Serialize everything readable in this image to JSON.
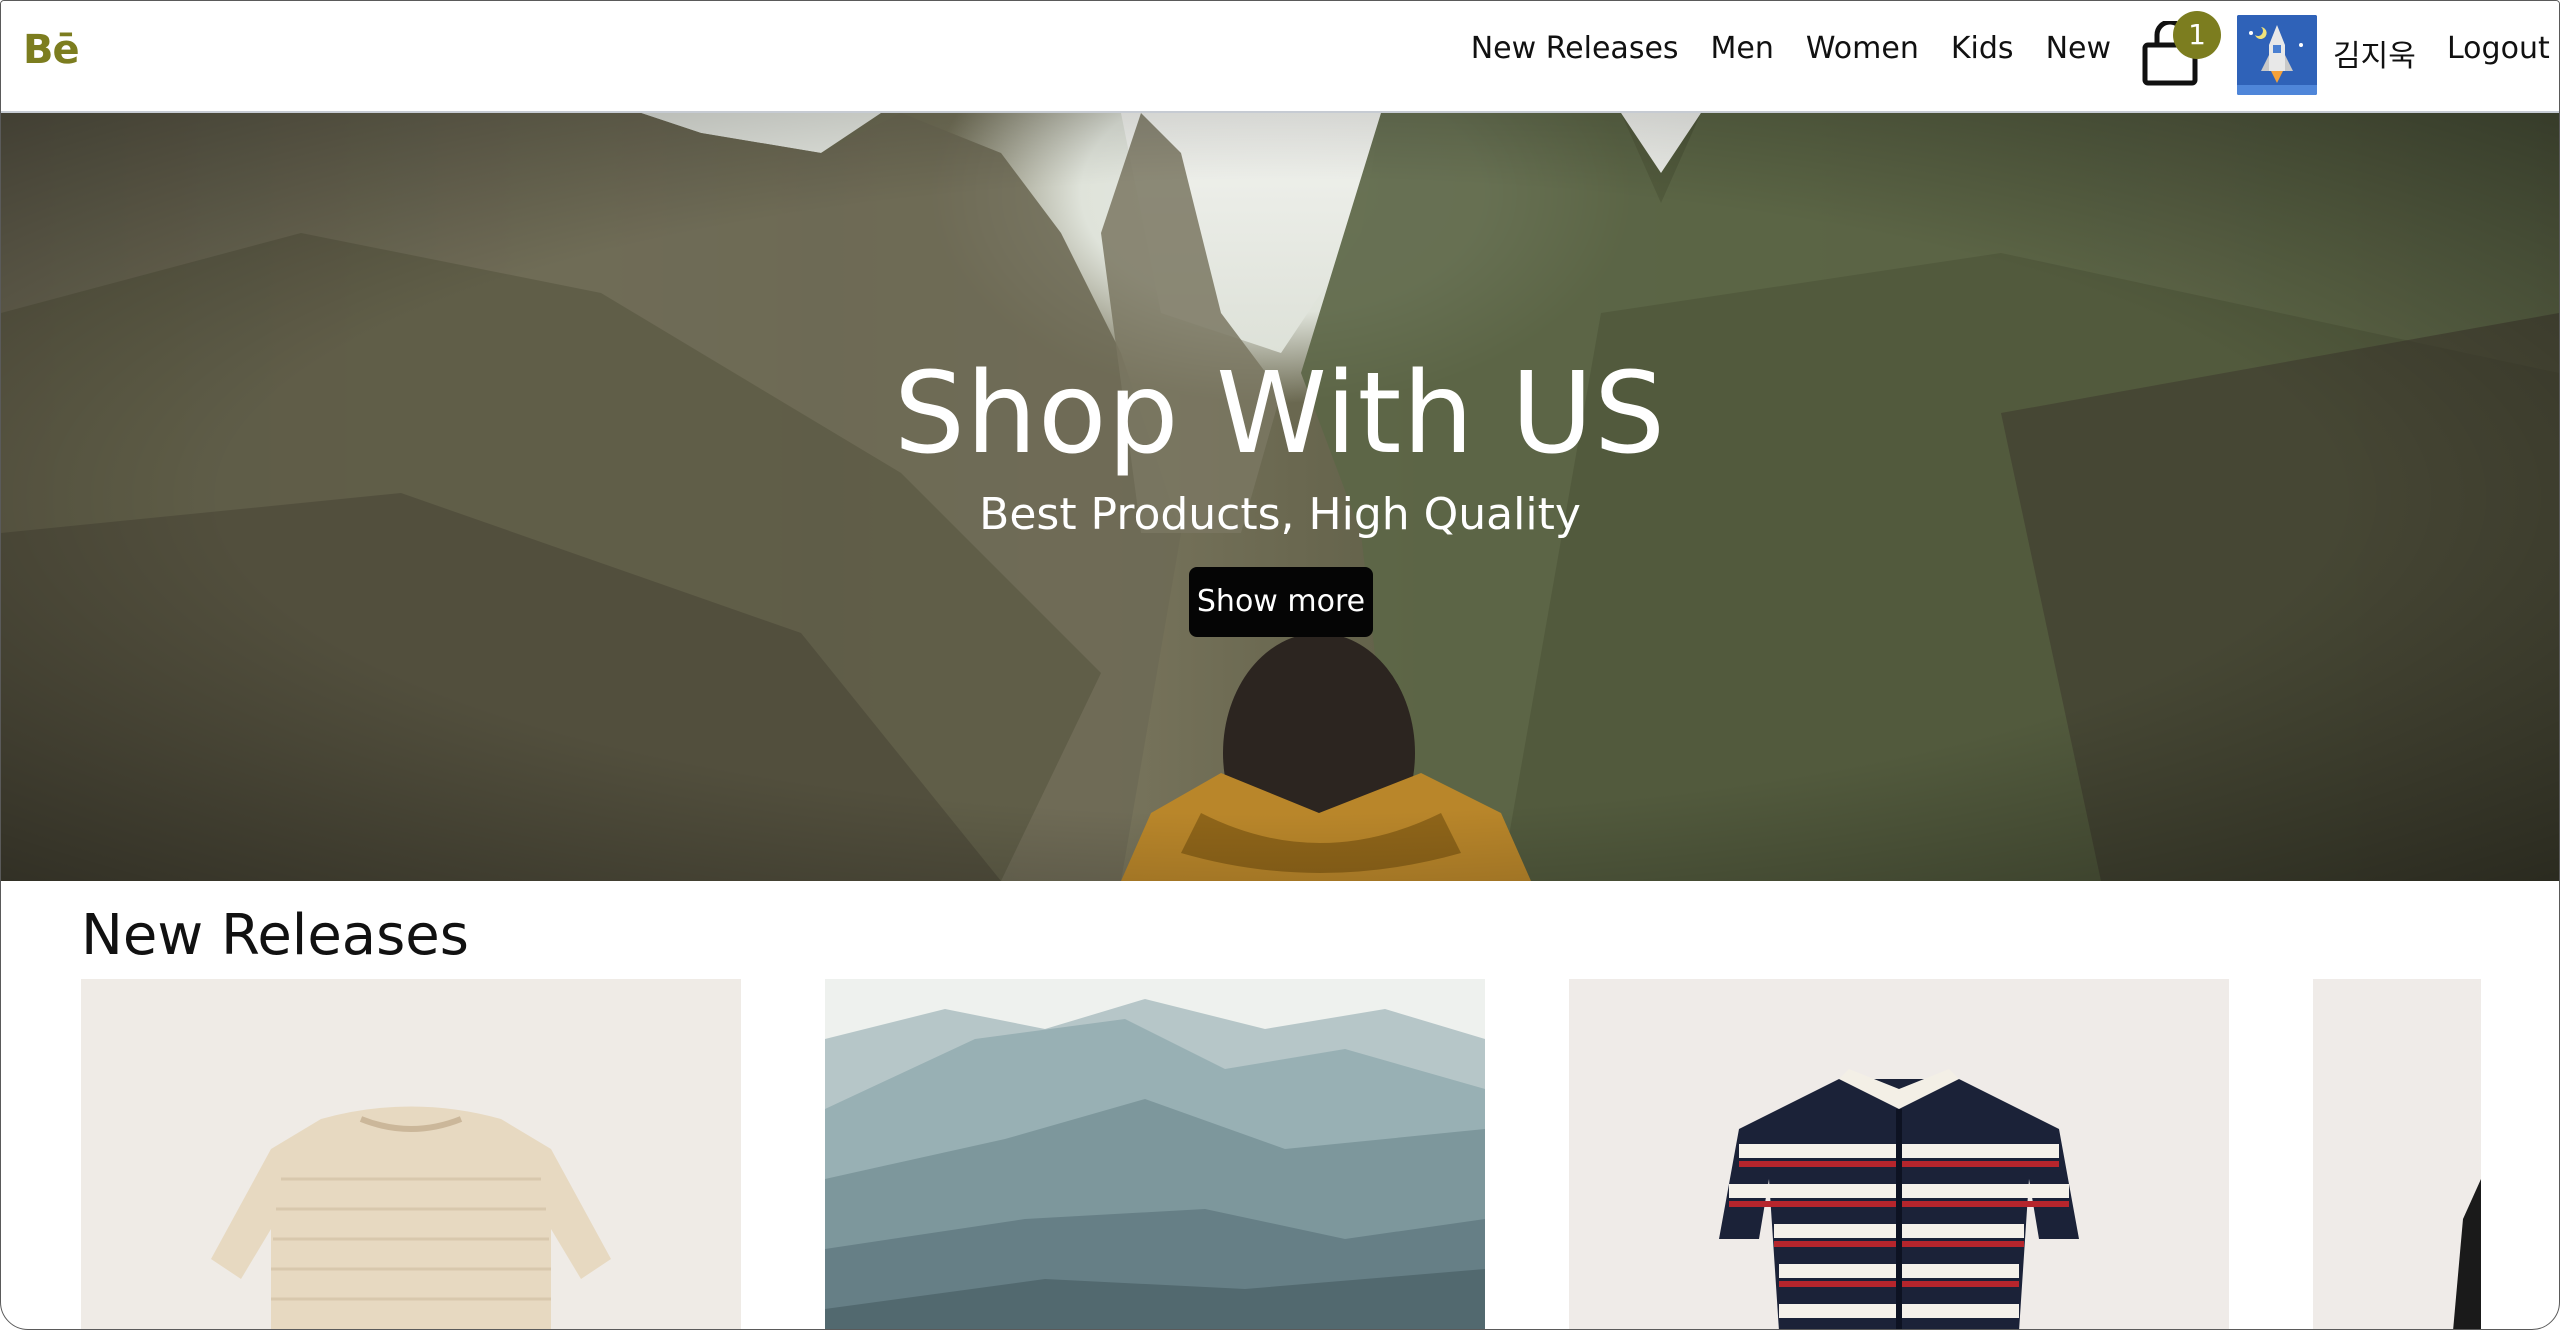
{
  "header": {
    "logo": "Bē",
    "nav": [
      "New Releases",
      "Men",
      "Women",
      "Kids",
      "New"
    ],
    "cart_count": "1",
    "user_name": "김지욱",
    "logout_label": "Logout"
  },
  "hero": {
    "title": "Shop With US",
    "subtitle": "Best Products, High Quality",
    "button_label": "Show more"
  },
  "new_releases": {
    "title": "New Releases"
  },
  "colors": {
    "accent": "#7c7d1f",
    "button_bg": "#050505",
    "avatar_bg": "#2f62b8"
  },
  "icons": [
    "shopping-bag-icon",
    "rocket-avatar-image"
  ]
}
